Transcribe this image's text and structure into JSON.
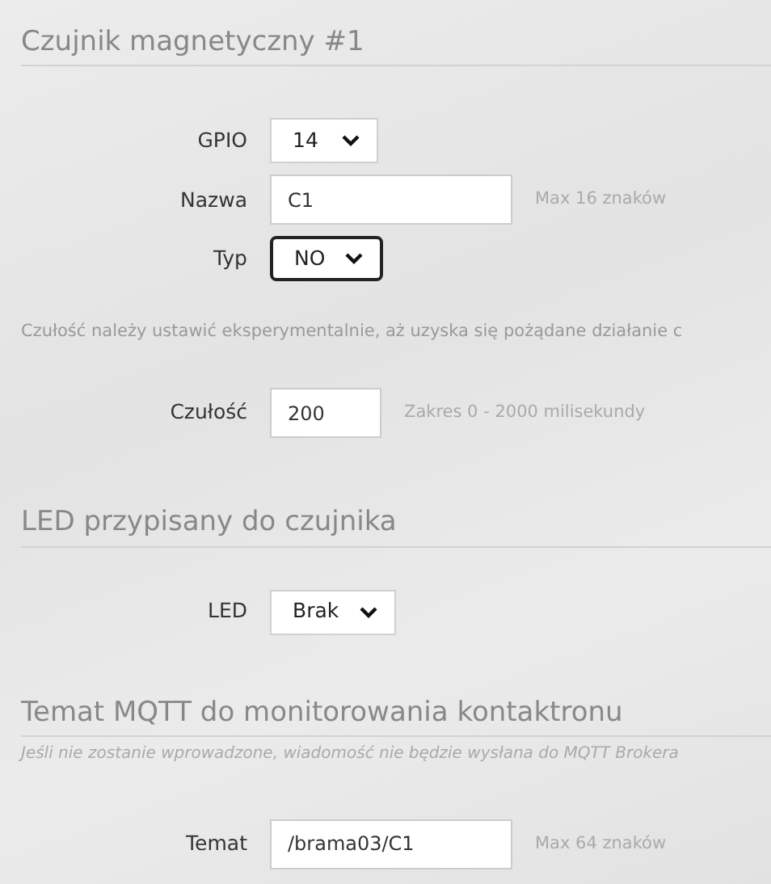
{
  "sections": [
    {
      "heading": "Czujnik magnetyczny #1",
      "items": [
        {
          "kind": "select",
          "label": "GPIO",
          "value": "14",
          "focused": false
        },
        {
          "kind": "input",
          "label": "Nazwa",
          "value": "C1",
          "hint": "Max 16 znaków"
        },
        {
          "kind": "select",
          "label": "Typ",
          "value": "NO",
          "focused": true
        },
        {
          "kind": "note",
          "text": "Czułość należy ustawić eksperymentalnie, aż uzyska się pożądane działanie c"
        },
        {
          "kind": "number",
          "label": "Czułość",
          "value": "200",
          "hint": "Zakres 0 - 2000 milisekundy"
        }
      ]
    },
    {
      "heading": "LED przypisany do czujnika",
      "items": [
        {
          "kind": "select",
          "label": "LED",
          "value": "Brak",
          "focused": false
        }
      ]
    },
    {
      "heading": "Temat MQTT do monitorowania kontaktronu",
      "subtitle": "Jeśli nie zostanie wprowadzone, wiadomość nie będzie wysłana do MQTT Brokera",
      "items": [
        {
          "kind": "input",
          "label": "Temat",
          "value": "/brama03/C1",
          "hint": "Max 64 znaków"
        }
      ]
    }
  ]
}
